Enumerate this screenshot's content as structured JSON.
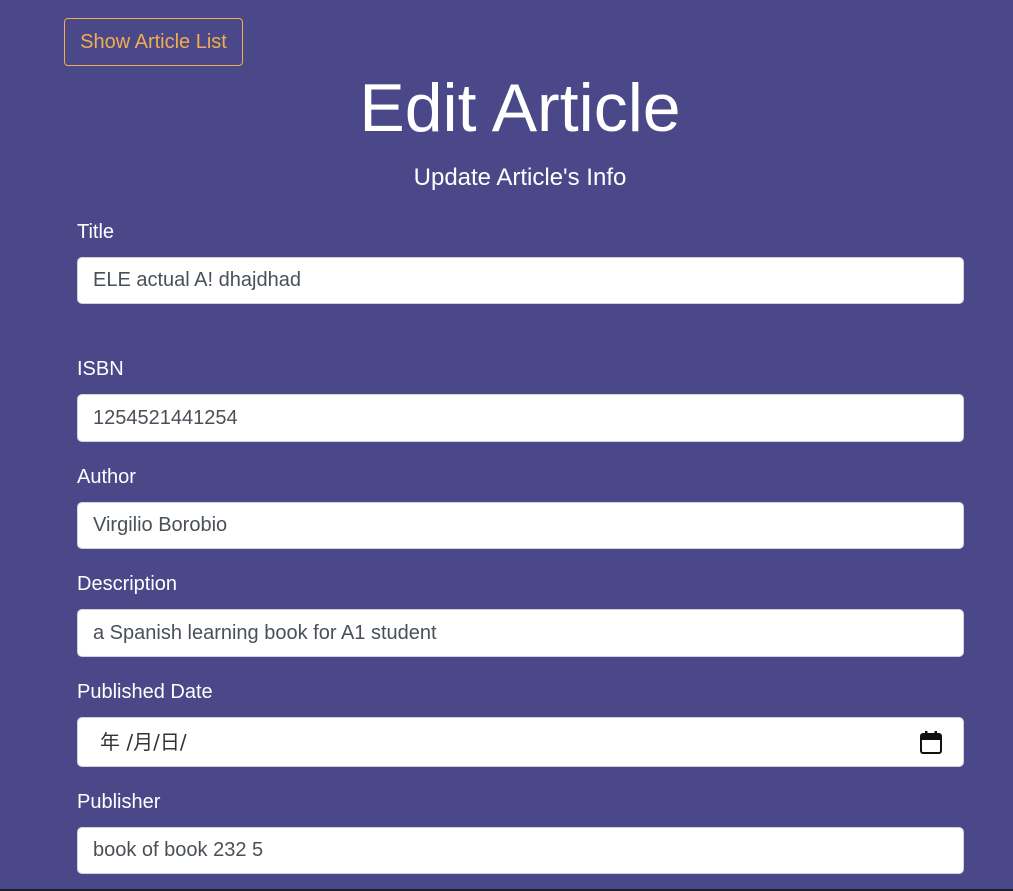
{
  "header": {
    "show_list_label": "Show Article List",
    "title": "Edit Article",
    "subtitle": "Update Article's Info"
  },
  "form": {
    "title": {
      "label": "Title",
      "value": "ELE actual A! dhajdhad"
    },
    "isbn": {
      "label": "ISBN",
      "value": "1254521441254"
    },
    "author": {
      "label": "Author",
      "value": "Virgilio Borobio"
    },
    "description": {
      "label": "Description",
      "value": "a Spanish learning book for A1 student"
    },
    "published_date": {
      "label": "Published Date",
      "display": "年 /月/日/",
      "icon": "calendar-icon"
    },
    "publisher": {
      "label": "Publisher",
      "value": "book of book 232 5"
    }
  },
  "colors": {
    "background": "#4a4888",
    "accent": "#f0ad4e",
    "input_text": "#495057"
  }
}
